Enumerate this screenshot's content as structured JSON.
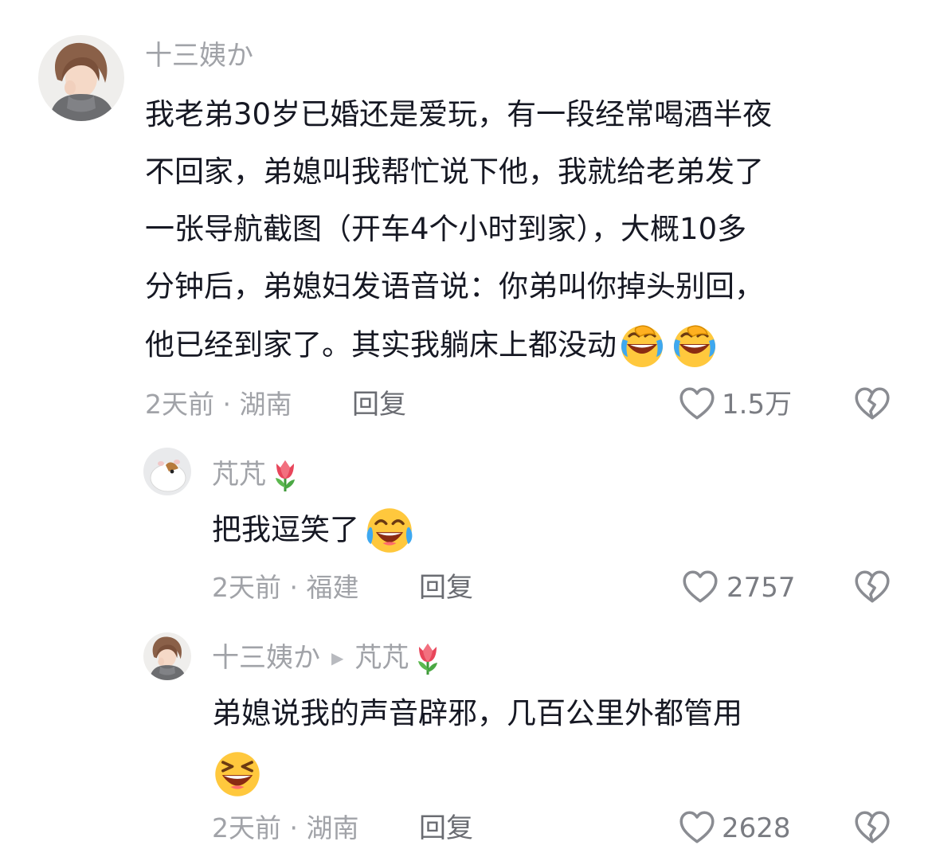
{
  "comments": [
    {
      "username": "十三姨か",
      "text_lines": [
        "我老弟30岁已婚还是爱玩，有一段经常喝酒半夜",
        "不回家，弟媳叫我帮忙说下他，我就给老弟发了",
        "一张导航截图（开车4个小时到家），大概10多",
        "分钟后，弟媳妇发语音说：你弟叫你掉头别回，",
        "他已经到家了。其实我躺床上都没动"
      ],
      "emojis": [
        "face-with-hand-over-mouth-laughing",
        "face-with-hand-over-mouth-laughing"
      ],
      "time_location": "2天前 · 湖南",
      "reply_label": "回复",
      "likes": "1.5万"
    },
    {
      "username": "芃芃",
      "username_emoji": "tulip",
      "text": "把我逗笑了",
      "emojis": [
        "face-with-tears-of-joy"
      ],
      "time_location": "2天前 · 福建",
      "reply_label": "回复",
      "likes": "2757"
    },
    {
      "username": "十三姨か",
      "reply_to": "芃芃",
      "reply_to_emoji": "tulip",
      "text": "弟媳说我的声音辟邪，几百公里外都管用",
      "emojis": [
        "grinning-squinting-face"
      ],
      "time_location": "2天前 · 湖南",
      "reply_label": "回复",
      "likes": "2628"
    }
  ],
  "icons": {
    "like": "heart-outline-icon",
    "dislike": "broken-heart-icon",
    "reply_arrow": "play-arrow-icon"
  },
  "colors": {
    "text_primary": "#161823",
    "text_secondary": "#a1a3a8",
    "reply_text": "#6a6c72",
    "icon": "#8a8c92",
    "tulip": "#e8455a",
    "emoji_yellow": "#ffc83d"
  }
}
